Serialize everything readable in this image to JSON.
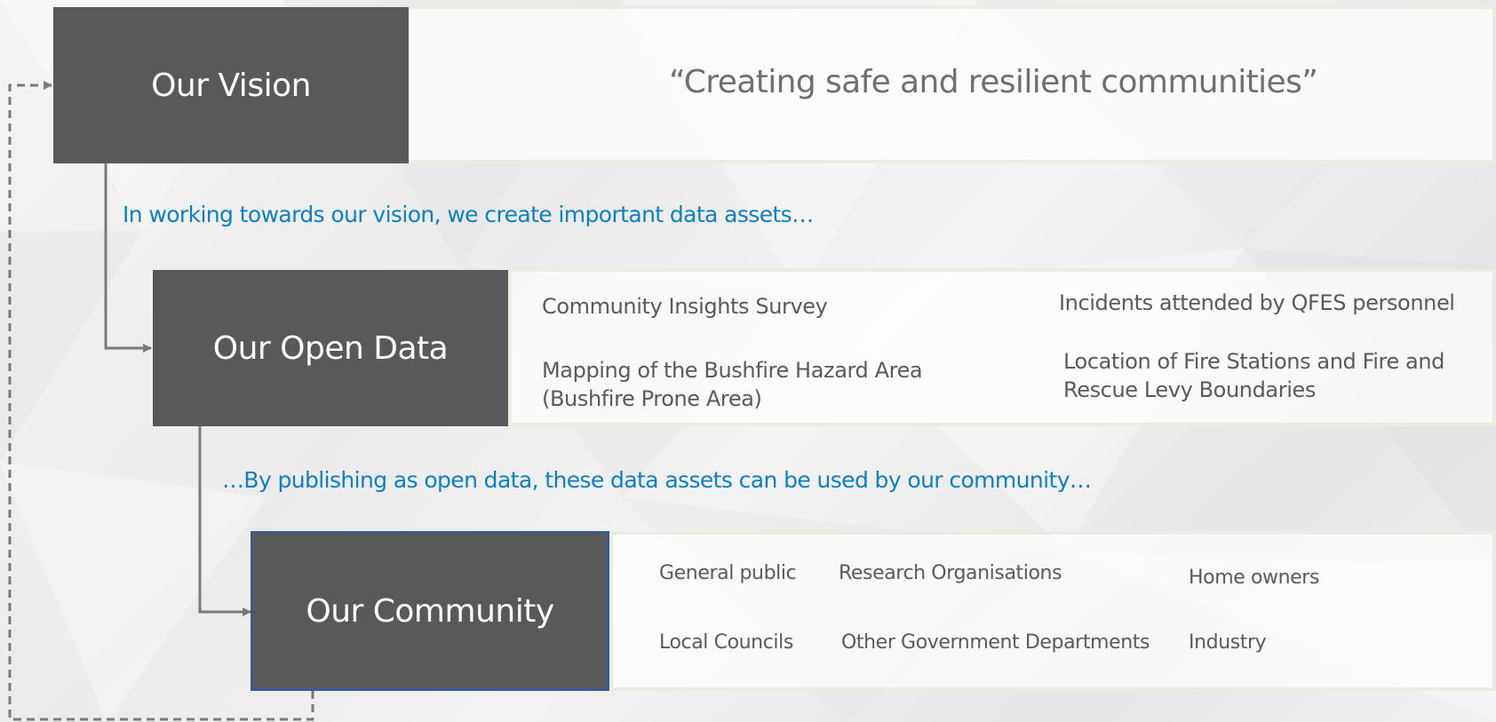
{
  "vision": {
    "box_label": "Our Vision",
    "statement": "“Creating safe and resilient communities”"
  },
  "caption_data": "In working towards our vision, we create important data assets…",
  "open_data": {
    "box_label": "Our Open Data",
    "assets": [
      {
        "lines": [
          "Community Insights Survey"
        ]
      },
      {
        "lines": [
          "Mapping of the Bushfire Hazard Area",
          "(Bushfire Prone Area)"
        ]
      },
      {
        "lines": [
          "Incidents attended by QFES personnel"
        ]
      },
      {
        "lines": [
          "Location of Fire Stations and Fire and",
          "Rescue Levy Boundaries"
        ]
      }
    ]
  },
  "caption_publish": "…By publishing as open data, these data assets can be used by our community…",
  "community": {
    "box_label": "Our Community",
    "groups": [
      "General public",
      "Research Organisations",
      "Home owners",
      "Local Councils",
      "Other Government Departments",
      "Industry"
    ]
  },
  "colors": {
    "box_fill": "#595959",
    "caption_text": "#0f7fc1",
    "community_border": "#3a5b8c",
    "connector": "#7a7a7a"
  }
}
